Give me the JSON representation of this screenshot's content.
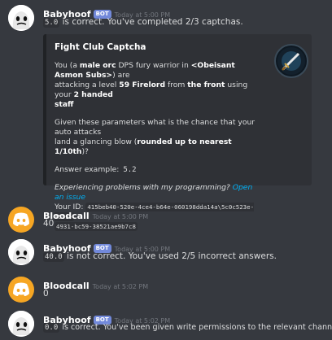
{
  "messages": [
    {
      "author": "Babyhoof",
      "badge": "BOT",
      "timestamp": "Today at 5:00 PM",
      "code": "5.0",
      "text": " is correct. You've completed 2/3 captchas."
    },
    {
      "author": "Bloodcall",
      "timestamp": "Today at 5:00 PM",
      "text": "40"
    },
    {
      "author": "Babyhoof",
      "badge": "BOT",
      "timestamp": "Today at 5:00 PM",
      "code": "40.0",
      "text": " is not correct. You've used 2/5 incorrect answers."
    },
    {
      "author": "Bloodcall",
      "timestamp": "Today at 5:02 PM",
      "text": "0"
    },
    {
      "author": "Babyhoof",
      "badge": "BOT",
      "timestamp": "Today at 5:02 PM",
      "code": "0.0",
      "text": " is correct. You've been given write permissions to the relevant channels."
    }
  ],
  "embed": {
    "title": "Fight Club Captcha",
    "p1": {
      "t1": "You (a ",
      "b1": "male orc",
      "t2": " DPS fury warrior in ",
      "b2": "<Obeisant Asmon Subs>",
      "t3": ") are",
      "t4": "attacking a level ",
      "b3": "59 Firelord",
      "t5": " from ",
      "b4": "the front",
      "t6": " using your ",
      "b5": "2 handed",
      "b6": "staff"
    },
    "p2": {
      "t1": "Given these parameters what is the chance that your auto attacks",
      "t2": "land a glancing blow (",
      "b1": "rounded up to nearest 1/10th",
      "t3": ")?"
    },
    "answer_label": "Answer example: ",
    "answer_example": "5.2",
    "problem_text": "Experiencing problems with my programming? ",
    "problem_link": "Open an issue",
    "id_label": "Your ID: ",
    "id_line1": "415beb40-520e-4ce4-b64e-060198dda14a\\5c0c523e-f555-",
    "id_line2": "4931-bc59-38521ae9b7c8"
  },
  "icons": {
    "bot_avatar": "ghost-face-icon",
    "user_avatar": "discord-logo-icon",
    "thumbnail": "sword-emblem-icon"
  },
  "colors": {
    "background": "#36393f",
    "embed_bg": "#2f3136",
    "badge": "#7289da",
    "link": "#00b0f4",
    "user_avatar": "#f6a623"
  }
}
